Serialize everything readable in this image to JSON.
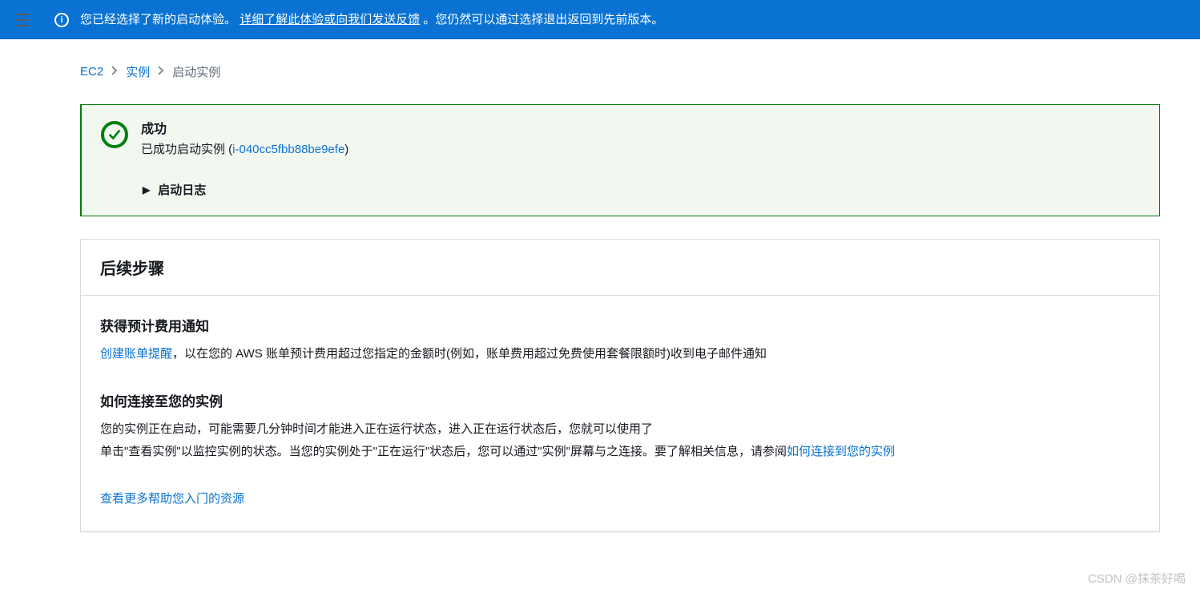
{
  "banner": {
    "text1": "您已经选择了新的启动体验。",
    "link": "详细了解此体验或向我们发送反馈",
    "text2": "。您仍然可以通过选择退出返回到先前版本。"
  },
  "breadcrumb": {
    "ec2": "EC2",
    "instances": "实例",
    "launch": "启动实例"
  },
  "success": {
    "title": "成功",
    "desc_prefix": "已成功启动实例 (",
    "instance_id": "i-040cc5fbb88be9efe",
    "desc_suffix": ")",
    "log_label": "启动日志"
  },
  "next_steps": {
    "heading": "后续步骤",
    "billing": {
      "title": "获得预计费用通知",
      "link": "创建账单提醒",
      "text": "，以在您的 AWS 账单预计费用超过您指定的金额时(例如，账单费用超过免费使用套餐限额时)收到电子邮件通知"
    },
    "connect": {
      "title": "如何连接至您的实例",
      "p1": "您的实例正在启动，可能需要几分钟时间才能进入正在运行状态，进入正在运行状态后，您就可以使用了",
      "p2_prefix": "单击\"查看实例\"以监控实例的状态。当您的实例处于\"正在运行\"状态后，您可以通过\"实例\"屏幕与之连接。要了解相关信息，请参阅",
      "p2_link": "如何连接到您的实例"
    },
    "more_link": "查看更多帮助您入门的资源"
  },
  "watermark": "CSDN @抹茶好喝"
}
